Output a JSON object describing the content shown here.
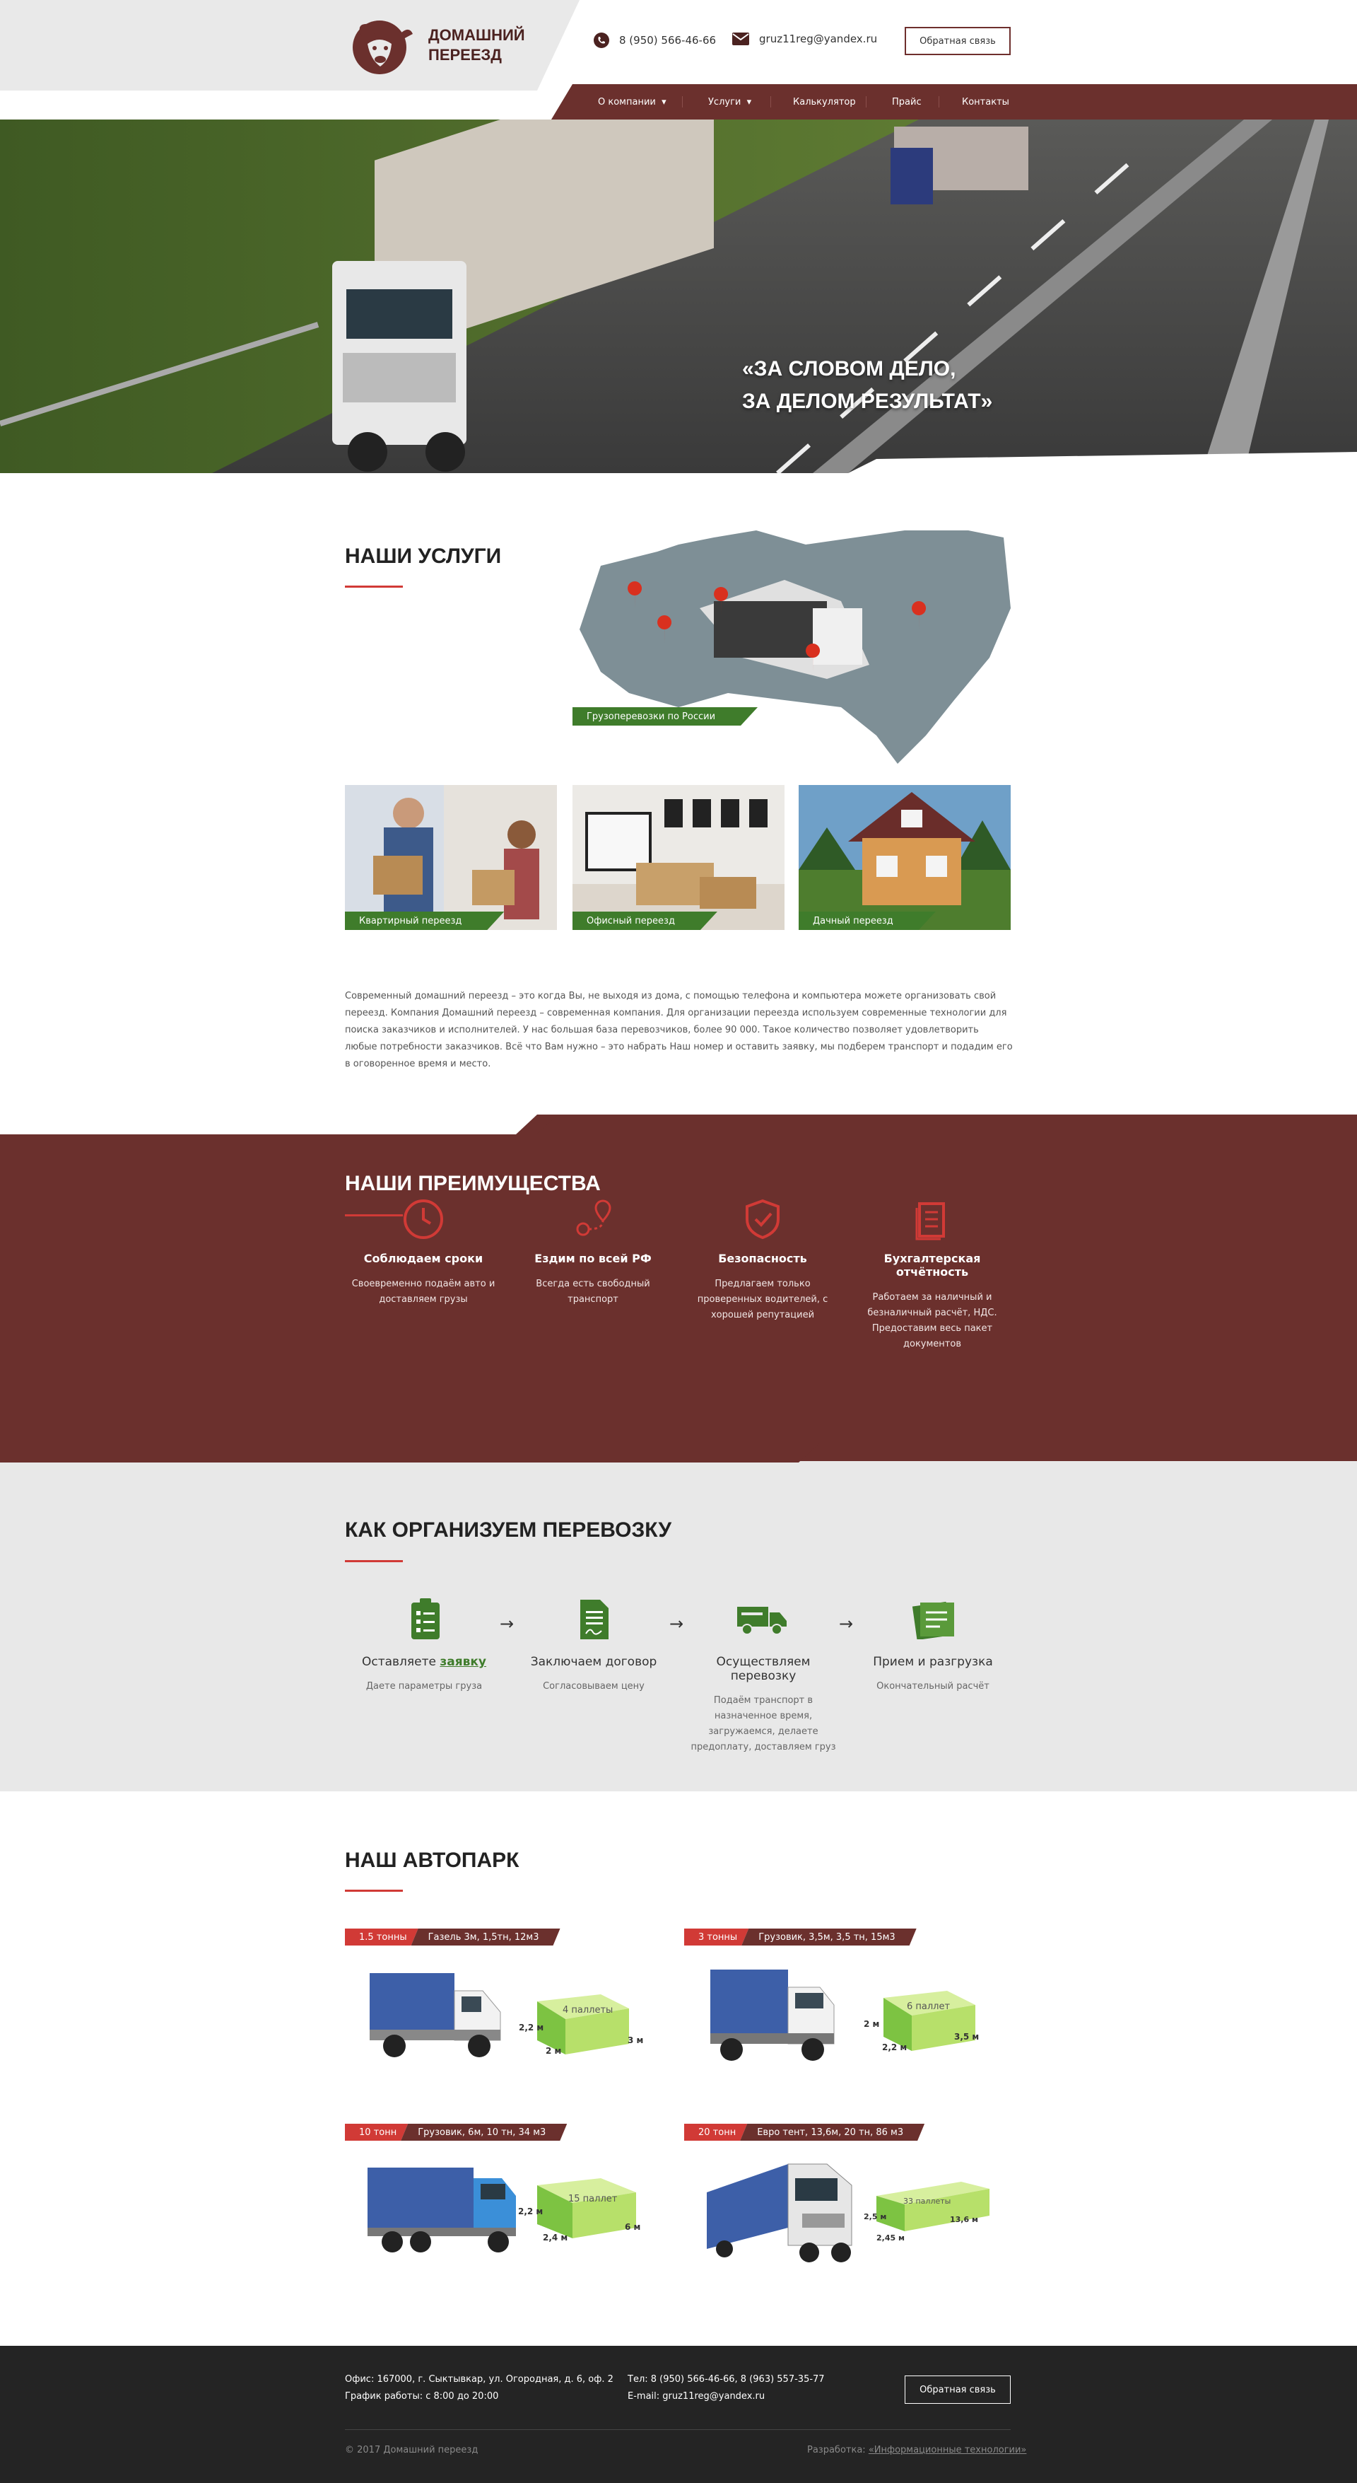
{
  "header": {
    "logo_line1": "ДОМАШНИЙ",
    "logo_line2": "ПЕРЕЕЗД",
    "phone": "8 (950) 566-46-66",
    "email": "gruz11reg@yandex.ru",
    "callback_label": "Обратная связь"
  },
  "nav": [
    {
      "label": "О компании",
      "caret": "▾"
    },
    {
      "label": "Услуги",
      "caret": "▾"
    },
    {
      "label": "Калькулятор"
    },
    {
      "label": "Прайс"
    },
    {
      "label": "Контакты"
    }
  ],
  "hero": {
    "slogan_line1": "«ЗА СЛОВОМ ДЕЛО,",
    "slogan_line2": "ЗА ДЕЛОМ РЕЗУЛЬТАТ»"
  },
  "services": {
    "title": "НАШИ УСЛУГИ",
    "cards": [
      {
        "label": "Грузоперевозки по России"
      },
      {
        "label": "Квартирный переезд"
      },
      {
        "label": "Офисный переезд"
      },
      {
        "label": "Дачный переезд"
      }
    ],
    "paragraph": "Современный домашний переезд – это когда Вы, не выходя из дома, с помощью телефона и компьютера можете организовать свой переезд. Компания Домашний переезд – современная компания. Для организации переезда используем современные технологии для поиска заказчиков и исполнителей. У нас большая база перевозчиков, более 90 000. Такое количество позволяет удовлетворить любые потребности заказчиков. Всё что Вам нужно – это набрать Наш номер и оставить заявку, мы подберем транспорт и подадим его в оговоренное время и место."
  },
  "advantages": {
    "title": "НАШИ ПРЕИМУЩЕСТВА",
    "items": [
      {
        "icon": "clock-icon",
        "title": "Соблюдаем сроки",
        "desc": "Своевременно подаём авто и доставляем грузы"
      },
      {
        "icon": "route-icon",
        "title": "Ездим по всей РФ",
        "desc": "Всегда есть свободный транспорт"
      },
      {
        "icon": "shield-icon",
        "title": "Безопасность",
        "desc": "Предлагаем только проверенных водителей, с хорошей репутацией"
      },
      {
        "icon": "documents-icon",
        "title": "Бухгалтерская отчётность",
        "desc": "Работаем за наличный и безналичный расчёт, НДС. Предоставим весь пакет документов"
      }
    ],
    "accent": "#d13a36",
    "bg": "#6b302d"
  },
  "process": {
    "title": "КАК ОРГАНИЗУЕМ ПЕРЕВОЗКУ",
    "steps": [
      {
        "icon": "checklist-icon",
        "title_prefix": "Оставляете ",
        "title_link": "заявку",
        "desc": "Даете параметры груза"
      },
      {
        "icon": "contract-icon",
        "title": "Заключаем договор",
        "desc": "Согласовываем цену"
      },
      {
        "icon": "truck-icon",
        "title": "Осуществляем перевозку",
        "desc": "Подаём транспорт в назначенное время, загружаемся, делаете предоплату, доставляем груз"
      },
      {
        "icon": "clipboard-icon",
        "title": "Прием и разгрузка",
        "desc": "Окончательный расчёт"
      }
    ],
    "arrow": "→",
    "green": "#3f7c2b"
  },
  "fleet": {
    "title": "НАШ АВТОПАРК",
    "items": [
      {
        "weight": "1.5 тонны",
        "spec": "Газель 3м, 1,5тн, 12м3",
        "pallets": "4 паллеты",
        "h": "2,2 м",
        "w": "2 м",
        "l": "3 м"
      },
      {
        "weight": "3 тонны",
        "spec": "Грузовик, 3,5м, 3,5 тн, 15м3",
        "pallets": "6 паллет",
        "h": "2 м",
        "w": "2,2 м",
        "l": "3,5 м"
      },
      {
        "weight": "10 тонн",
        "spec": "Грузовик, 6м, 10 тн, 34 м3",
        "pallets": "15 паллет",
        "h": "2,2 м",
        "w": "2,4 м",
        "l": "6 м"
      },
      {
        "weight": "20 тонн",
        "spec": "Евро тент, 13,6м, 20 тн, 86 м3",
        "pallets": "33 паллеты",
        "h": "2,5 м",
        "w": "2,45 м",
        "l": "13,6 м"
      }
    ]
  },
  "footer": {
    "office": "Офис: 167000, г. Сыктывкар, ул. Огородная, д. 6, оф. 2",
    "hours": "График работы: с 8:00 до 20:00",
    "phones": "Тел: 8 (950) 566-46-66, 8 (963) 557-35-77",
    "email": "E-mail: gruz11reg@yandex.ru",
    "callback_label": "Обратная связь",
    "copyright": "© 2017 Домашний переезд",
    "dev_prefix": "Разработка: ",
    "dev_link": "«Информационные технологии»"
  }
}
